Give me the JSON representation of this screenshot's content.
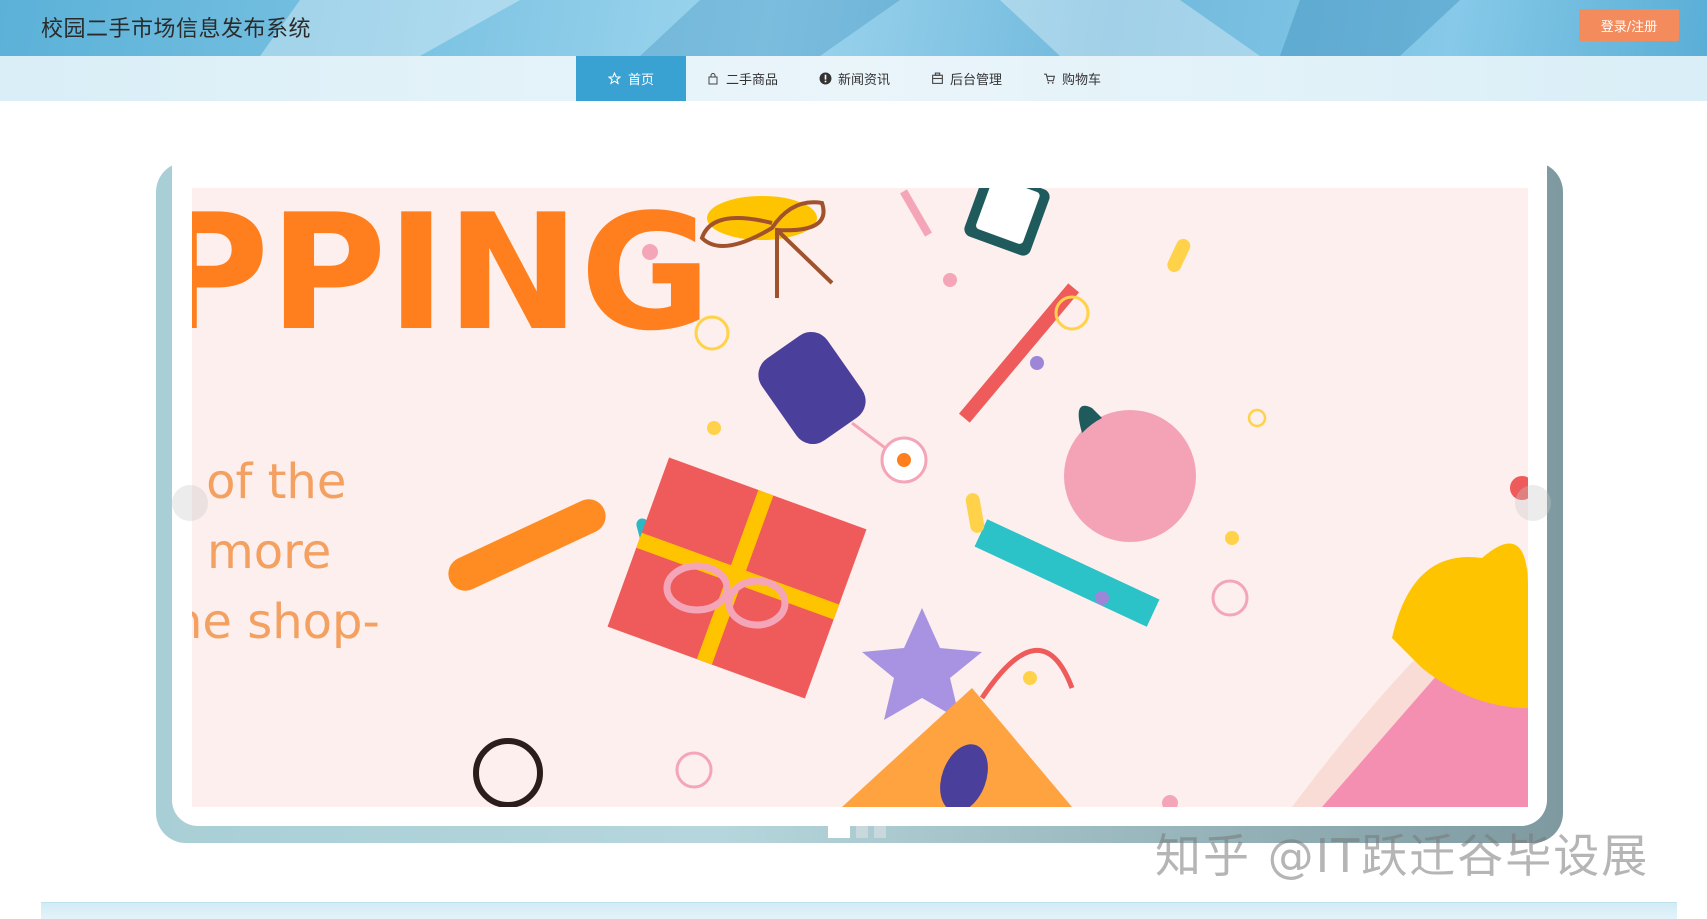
{
  "header": {
    "title": "校园二手市场信息发布系统",
    "login_label": "登录/注册"
  },
  "nav": {
    "items": [
      {
        "label": "首页",
        "icon": "star-icon"
      },
      {
        "label": "二手商品",
        "icon": "bag-icon"
      },
      {
        "label": "新闻资讯",
        "icon": "info-icon"
      },
      {
        "label": "后台管理",
        "icon": "building-icon"
      },
      {
        "label": "购物车",
        "icon": "cart-icon"
      }
    ],
    "active_index": 0
  },
  "banner": {
    "headline": "PPING",
    "lines": [
      "t of the",
      "more",
      "ne shop-"
    ]
  },
  "carousel": {
    "slide_count": 3,
    "active_index": 0
  },
  "watermark": "知乎 @IT跃迁谷毕设展",
  "colors": {
    "accent": "#3aa1d3",
    "login": "#f38b5c",
    "banner_orange": "#ff7f1e"
  }
}
